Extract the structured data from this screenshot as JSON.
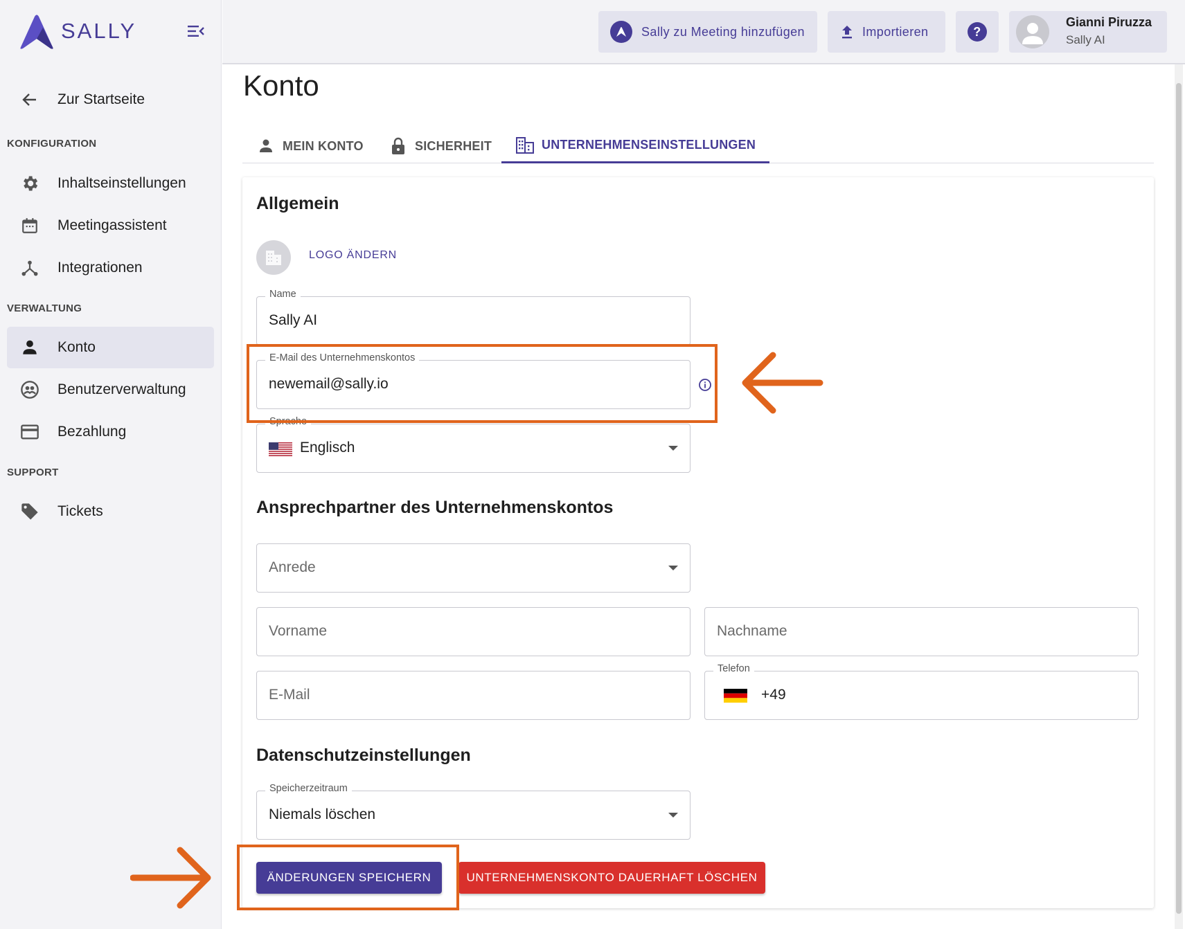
{
  "app": {
    "brand": "SALLY"
  },
  "sidebar": {
    "back": "Zur Startseite",
    "sections": {
      "config": "KONFIGURATION",
      "admin": "VERWALTUNG",
      "support": "SUPPORT"
    },
    "items": {
      "content": "Inhaltseinstellungen",
      "meeting": "Meetingassistent",
      "integrations": "Integrationen",
      "account": "Konto",
      "users": "Benutzerverwaltung",
      "billing": "Bezahlung",
      "tickets": "Tickets"
    }
  },
  "topbar": {
    "add_meeting": "Sally zu Meeting hinzufügen",
    "import": "Importieren",
    "help": "?",
    "user_name": "Gianni Piruzza",
    "user_org": "Sally AI"
  },
  "page": {
    "title": "Konto",
    "tabs": {
      "my_account": "MEIN KONTO",
      "security": "SICHERHEIT",
      "company": "UNTERNEHMENSEINSTELLUNGEN"
    }
  },
  "general": {
    "title": "Allgemein",
    "change_logo": "LOGO ÄNDERN",
    "name_label": "Name",
    "name_value": "Sally AI",
    "email_label": "E-Mail des Unternehmenskontos",
    "email_value": "newemail@sally.io",
    "language_label": "Sprache",
    "language_value": "Englisch"
  },
  "contact": {
    "title": "Ansprechpartner des Unternehmenskontos",
    "salutation_placeholder": "Anrede",
    "firstname_placeholder": "Vorname",
    "lastname_placeholder": "Nachname",
    "email_placeholder": "E-Mail",
    "phone_label": "Telefon",
    "phone_value": "+49"
  },
  "privacy": {
    "title": "Datenschutzeinstellungen",
    "retention_label": "Speicherzeitraum",
    "retention_value": "Niemals löschen"
  },
  "actions": {
    "save": "ÄNDERUNGEN SPEICHERN",
    "delete": "UNTERNEHMENSKONTO DAUERHAFT LÖSCHEN"
  },
  "colors": {
    "brand": "#463c96",
    "danger": "#d9302c",
    "annotation": "#e0641c"
  }
}
